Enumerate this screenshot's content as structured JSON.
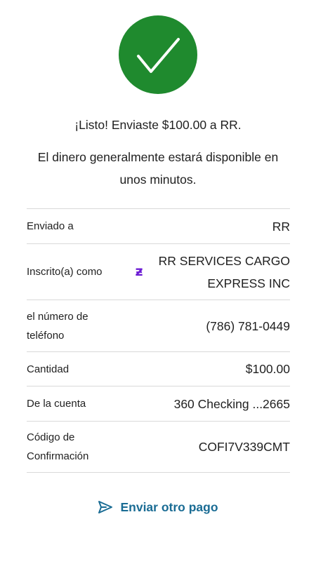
{
  "colors": {
    "success_green": "#1f8a2e",
    "accent_blue": "#1a6c94",
    "zelle_purple": "#6d1ed4",
    "divider": "#d9d9d9"
  },
  "confirmation": {
    "icon": "checkmark-icon",
    "headline": "¡Listo! Enviaste $100.00 a RR.",
    "subline": "El dinero generalmente estará disponible en unos minutos."
  },
  "details": [
    {
      "label": "Enviado a",
      "value": "RR"
    },
    {
      "label": "Inscrito(a) como",
      "value": "RR SERVICES CARGO EXPRESS INC",
      "icon": "zelle-icon",
      "icon_glyph": "ƶ"
    },
    {
      "label": "el número de teléfono",
      "value": "(786) 781-0449"
    },
    {
      "label": "Cantidad",
      "value": "$100.00"
    },
    {
      "label": "De la cuenta",
      "value": "360 Checking ...2665"
    },
    {
      "label": "Código de Confirmación",
      "value": "COFI7V339CMT"
    }
  ],
  "actions": {
    "send_another_label": "Enviar otro pago",
    "send_icon": "send-icon"
  }
}
